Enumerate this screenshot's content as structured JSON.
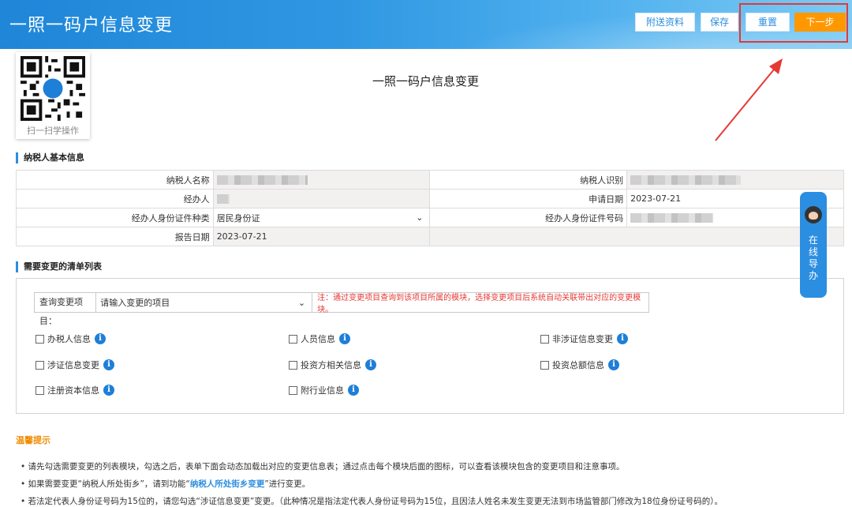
{
  "header": {
    "title": "一照一码户信息变更",
    "buttons": {
      "attach": "附送资料",
      "save": "保存",
      "reset": "重置",
      "next": "下一步"
    }
  },
  "qr": {
    "caption": "扫一扫学操作"
  },
  "page_title": "一照一码户信息变更",
  "basic_info": {
    "section_title": "纳税人基本信息",
    "taxpayer_name_label": "纳税人名称",
    "taxpayer_id_label": "纳税人识别",
    "agent_label": "经办人",
    "apply_date_label": "申请日期",
    "apply_date_value": "2023-07-21",
    "agent_id_type_label": "经办人身份证件种类",
    "agent_id_type_value": "居民身份证",
    "agent_id_no_label": "经办人身份证件号码",
    "report_date_label": "报告日期",
    "report_date_value": "2023-07-21"
  },
  "change_list": {
    "section_title": "需要变更的清单列表",
    "query_label": "查询变更项目：",
    "query_placeholder": "请输入变更的项目",
    "query_note": "注：通过变更项目查询到该项目所属的模块，选择变更项目后系统自动关联带出对应的变更模块。",
    "items": [
      "办税人信息",
      "人员信息",
      "非涉证信息变更",
      "涉证信息变更",
      "投资方相关信息",
      "投资总额信息",
      "注册资本信息",
      "附行业信息"
    ]
  },
  "tips": {
    "title": "温馨提示",
    "line1": "请先勾选需要变更的列表模块，勾选之后，表单下面会动态加载出对应的变更信息表；通过点击每个模块后面的图标，可以查看该模块包含的变更项目和注意事项。",
    "line2_prefix": "如果需要变更“纳税人所处街乡”，请到功能“",
    "line2_link": "纳税人所处街乡变更",
    "line2_suffix": "”进行变更。",
    "line3": "若法定代表人身份证号码为15位的，请您勾选“涉证信息变更”变更。（此种情况是指法定代表人身份证号码为15位，且因法人姓名未发生变更无法到市场监管部门修改为18位身份证号码的）。"
  },
  "guide": {
    "label": "在线导办"
  },
  "colors": {
    "primary": "#2b8ee0",
    "accent": "#ff9800",
    "warning": "#e53935",
    "tip_title": "#f08c00"
  }
}
